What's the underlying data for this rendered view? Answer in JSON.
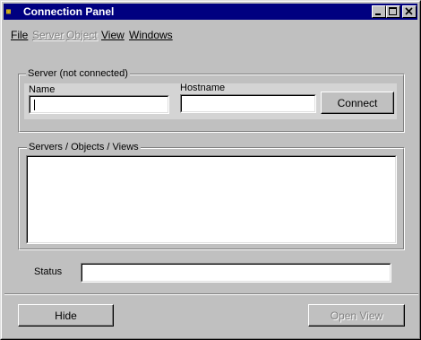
{
  "window": {
    "title": "Connection Panel",
    "icon": "app-icon",
    "controls": [
      "minimize-icon",
      "maximize-icon",
      "close-icon"
    ]
  },
  "menu": {
    "file": "File",
    "server": "Server",
    "object": "Object",
    "view": "View",
    "windows": "Windows"
  },
  "server_group": {
    "legend": "Server (not connected)",
    "name_label": "Name",
    "name_value": "",
    "hostname_label": "Hostname",
    "hostname_value": "",
    "connect_label": "Connect"
  },
  "tree_group": {
    "legend": "Servers / Objects / Views",
    "items": []
  },
  "status": {
    "label": "Status",
    "value": ""
  },
  "footer": {
    "hide_label": "Hide",
    "open_view_label": "Open View"
  }
}
